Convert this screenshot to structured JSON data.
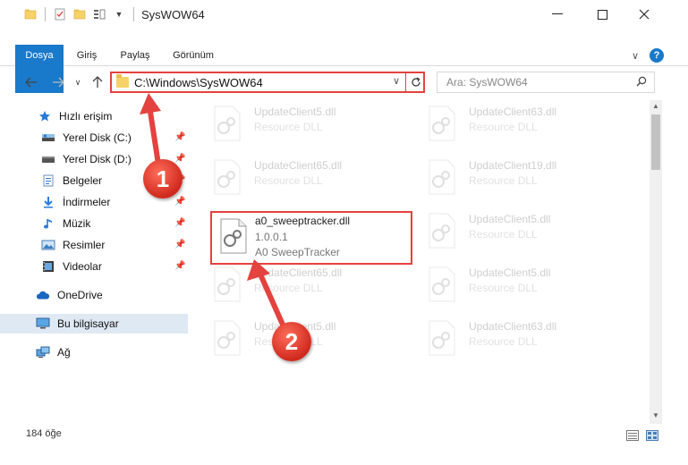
{
  "window": {
    "title": "SysWOW64",
    "controls": {
      "minimize": "—",
      "maximize": "☐",
      "close": "✕"
    }
  },
  "ribbon": {
    "tabs": [
      "Dosya",
      "Giriş",
      "Paylaş",
      "Görünüm"
    ],
    "help": "?"
  },
  "address": {
    "path": "C:\\Windows\\SysWOW64",
    "search_placeholder": "Ara: SysWOW64"
  },
  "sidebar": {
    "items": [
      {
        "label": "Hızlı erişim",
        "icon": "star-icon"
      },
      {
        "label": "Yerel Disk (C:)",
        "icon": "drive-icon"
      },
      {
        "label": "Yerel Disk (D:)",
        "icon": "drive-icon"
      },
      {
        "label": "Belgeler",
        "icon": "documents-icon"
      },
      {
        "label": "İndirmeler",
        "icon": "download-icon"
      },
      {
        "label": "Müzik",
        "icon": "music-icon"
      },
      {
        "label": "Resimler",
        "icon": "pictures-icon"
      },
      {
        "label": "Videolar",
        "icon": "video-icon"
      },
      {
        "label": "OneDrive",
        "icon": "cloud-icon"
      },
      {
        "label": "Bu bilgisayar",
        "icon": "computer-icon"
      },
      {
        "label": "Ağ",
        "icon": "network-icon"
      }
    ]
  },
  "files": [
    {
      "name": "UpdateClient5.dll",
      "desc": "Resource DLL"
    },
    {
      "name": "UpdateClient63.dll",
      "desc": "Resource DLL"
    },
    {
      "name": "UpdateClient65.dll",
      "desc": "Resource DLL"
    },
    {
      "name": "UpdateClient19.dll",
      "desc": "Resource DLL"
    },
    {
      "name": "a0_sweeptracker.dll",
      "version": "1.0.0.1",
      "desc": "A0 SweepTracker"
    },
    {
      "name": "UpdateClient5.dll",
      "desc": "Resource DLL"
    },
    {
      "name": "UpdateClient65.dll",
      "desc": "Resource DLL"
    },
    {
      "name": "UpdateClient5.dll",
      "desc": "Resource DLL"
    },
    {
      "name": "UpdateClient5.dll",
      "desc": "Resource DLL"
    },
    {
      "name": "UpdateClient5.dll",
      "desc": "Resource DLL"
    },
    {
      "name": "UpdateClient5.dll",
      "desc": "Resource DLL"
    },
    {
      "name": "UpdateClient63.dll",
      "desc": "Resource DLL"
    }
  ],
  "status": {
    "count": "184 öğe"
  },
  "annotations": {
    "step1": "1",
    "step2": "2"
  },
  "colors": {
    "accent": "#1979ca",
    "highlight": "#e4423f",
    "selected": "#dfe9f4"
  }
}
